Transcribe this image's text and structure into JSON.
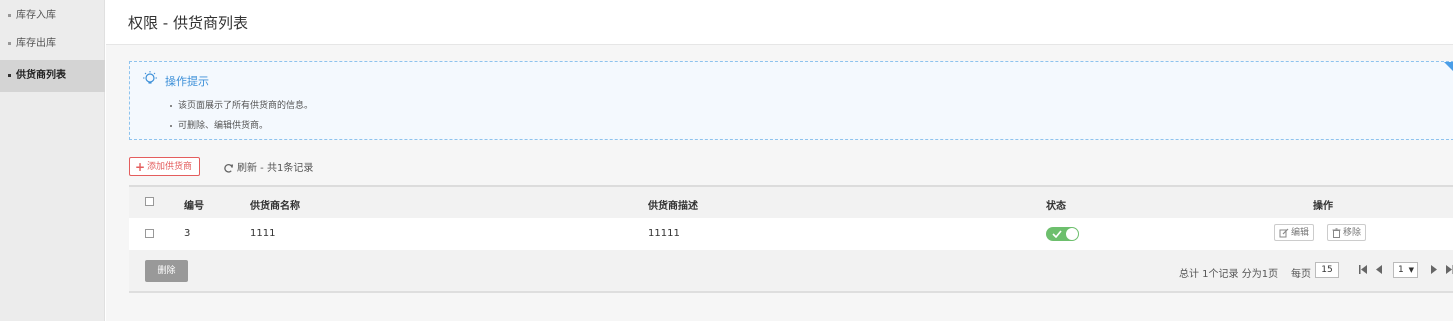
{
  "sidebar": {
    "items": [
      {
        "label": "库存入库",
        "active": false
      },
      {
        "label": "库存出库",
        "active": false
      },
      {
        "label": "供货商列表",
        "active": true
      }
    ]
  },
  "header": {
    "title": "权限 - 供货商列表"
  },
  "tips": {
    "icon": "lightbulb-icon",
    "title": "操作提示",
    "lines": [
      "该页面展示了所有供货商的信息。",
      "可删除、编辑供货商。"
    ]
  },
  "toolbar": {
    "add_label": "添加供货商",
    "refresh_label": "刷新 - 共1条记录"
  },
  "table": {
    "headers": {
      "id": "编号",
      "name": "供货商名称",
      "desc": "供货商描述",
      "status": "状态",
      "actions": "操作"
    },
    "rows": [
      {
        "id": "3",
        "name": "1111",
        "desc": "11111",
        "status_on": true,
        "edit_label": "编辑",
        "remove_label": "移除"
      }
    ]
  },
  "footer": {
    "delete_label": "删除",
    "summary": "总计 1个记录 分为1页",
    "per_page_label": "每页",
    "per_page_value": "15",
    "current_page": "1"
  },
  "colors": {
    "accent": "#3b8fd8",
    "danger": "#e45d5d",
    "toggle_on": "#6dbf6d"
  }
}
